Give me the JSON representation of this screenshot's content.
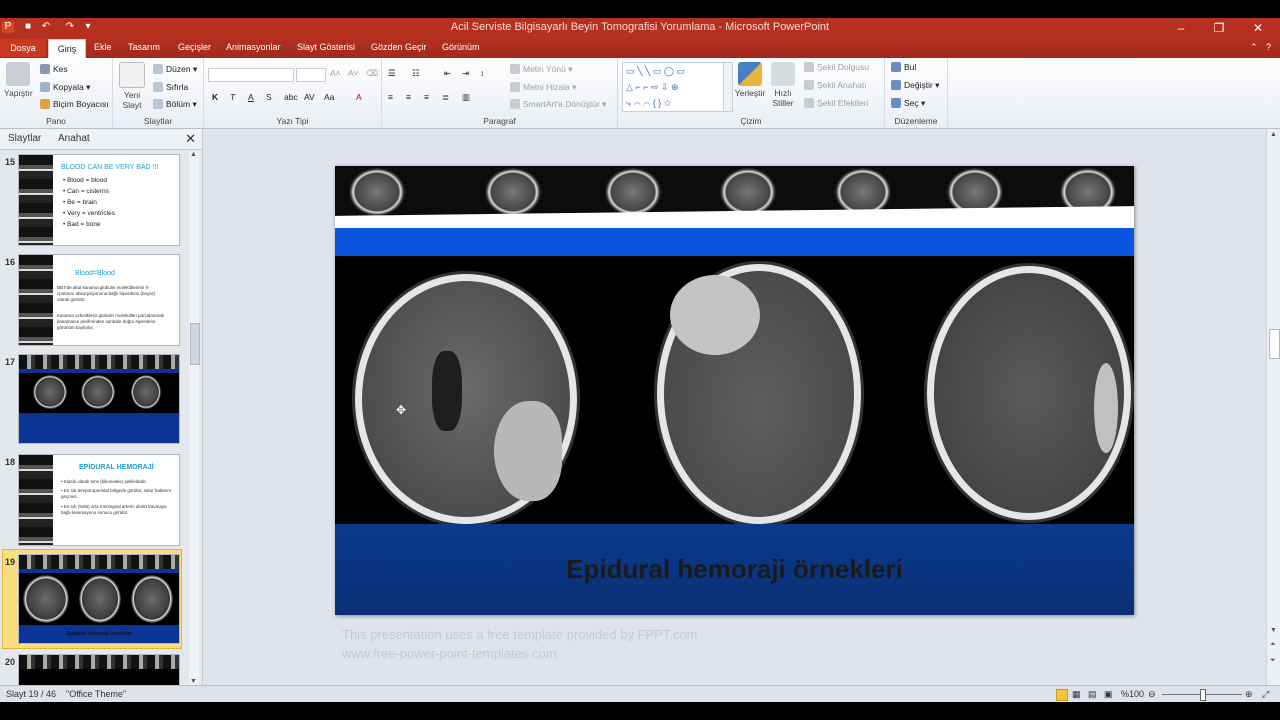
{
  "window": {
    "title": "Acil Serviste Bilgisayarlı Beyin Tomografisi Yorumlama  -  Microsoft PowerPoint"
  },
  "tabs": {
    "file": "Dosya",
    "items": [
      "Giriş",
      "Ekle",
      "Tasarım",
      "Geçişler",
      "Animasyonlar",
      "Slayt Gösterisi",
      "Gözden Geçir",
      "Görünüm"
    ]
  },
  "ribbon": {
    "pano": {
      "paste": "Yapıştır",
      "cut": "Kes",
      "copy": "Kopyala",
      "format_painter": "Biçim Boyacısı",
      "label": "Pano"
    },
    "slaytlar": {
      "new_slide_1": "Yeni",
      "new_slide_2": "Slayt",
      "layout": "Düzen",
      "reset": "Sıfırla",
      "section": "Bölüm",
      "label": "Slaytlar"
    },
    "font": {
      "label": "Yazı Tipi",
      "bold": "K",
      "italic": "T",
      "underline": "A",
      "strike": "S",
      "spacing": "abc",
      "case": "AV",
      "color": "A"
    },
    "paragraph": {
      "label": "Paragraf",
      "text_direction": "Metin Yönü",
      "align_text": "Metni Hizala",
      "smartart": "SmartArt'a Dönüştür"
    },
    "drawing": {
      "label": "Çizim",
      "arrange": "Yerleştir",
      "quick_styles_1": "Hızlı",
      "quick_styles_2": "Stiller",
      "fill": "Şekil Dolgusu",
      "outline": "Şekil Anahatı",
      "effects": "Şekil Efektleri"
    },
    "editing": {
      "label": "Düzenleme",
      "find": "Bul",
      "replace": "Değiştir",
      "select": "Seç"
    }
  },
  "panel": {
    "tab_slides": "Slaytlar",
    "tab_outline": "Anahat",
    "close": "✕",
    "slides": [
      {
        "num": "15",
        "title": "BLOOD CAN  BE VERY BAD !!!",
        "lines": [
          "Blood = blood",
          "Can = cisterns",
          "Be = brain",
          "Very = ventricles",
          "Bad = bone"
        ]
      },
      {
        "num": "16",
        "title": "Blood=Blood",
        "lines": [
          "BBT'de  akut kanama globulin moleküllerinin X-ışınlarını absorpsiyonuna bağlı hiperdens (beyaz) olarak görülür.",
          "Kanama ozkotikleşir globulin molekülleri parçalanarak kanamanın periferinden santrale doğru hiperdens görünüm kaybolur."
        ]
      },
      {
        "num": "17",
        "title": "",
        "lines": []
      },
      {
        "num": "18",
        "title": "EPİDURAL HEMORAJİ",
        "lines": [
          "Klasik olarak lens (bikonveks) şeklindedir.",
          "En sık temporoparietal bölgede görülür, sütur hatlarını geçmez..",
          "En sık (%85) orta meningeal arterin direkt travmaya bağlı laserasyonu sonucu görülür."
        ]
      },
      {
        "num": "19",
        "title": "Epidural hemoraji örnekleri",
        "lines": []
      },
      {
        "num": "20",
        "title": "",
        "lines": []
      }
    ]
  },
  "slide": {
    "caption": "Epidural hemoraji örnekleri"
  },
  "notes": {
    "line1": "This presentation uses a free template provided by FPPT.com",
    "line2": "www.free-power-point-templates.com"
  },
  "status": {
    "slide_counter": "Slayt 19 / 46",
    "theme": "\"Office Theme\"",
    "zoom": "%100"
  },
  "colors": {
    "title_bar": "#b53021",
    "slide_blue": "#0b55e0",
    "caption_blue": "#0a3a8c",
    "selected_thumb": "#f5d76e"
  }
}
